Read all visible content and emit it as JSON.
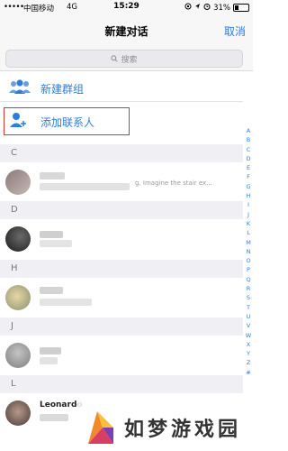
{
  "statusbar": {
    "signal": "•••••",
    "carrier": "中国移动",
    "network": "4G",
    "time": "15:29",
    "battery": "31%",
    "battery_level": 0.31
  },
  "navbar": {
    "title": "新建对话",
    "cancel": "取消"
  },
  "search": {
    "placeholder": "搜索"
  },
  "actions": [
    {
      "label": "新建群组",
      "icon": "group-icon"
    },
    {
      "label": "添加联系人",
      "icon": "add-contact-icon"
    }
  ],
  "sections": [
    "C",
    "D",
    "H",
    "J",
    "L"
  ],
  "contacts": {
    "c_preview": "g. Imagine the stair ex...",
    "l_name": "Leonardo"
  },
  "index_letters": [
    "A",
    "B",
    "C",
    "D",
    "E",
    "F",
    "G",
    "H",
    "I",
    "J",
    "K",
    "L",
    "M",
    "N",
    "O",
    "P",
    "Q",
    "R",
    "S",
    "T",
    "U",
    "V",
    "W",
    "X",
    "Y",
    "Z",
    "#"
  ],
  "watermark": {
    "text": "如梦游戏园"
  },
  "colors": {
    "accent": "#2b7ee0",
    "highlight": "#d33a2c",
    "section_bg": "#efeff4"
  }
}
